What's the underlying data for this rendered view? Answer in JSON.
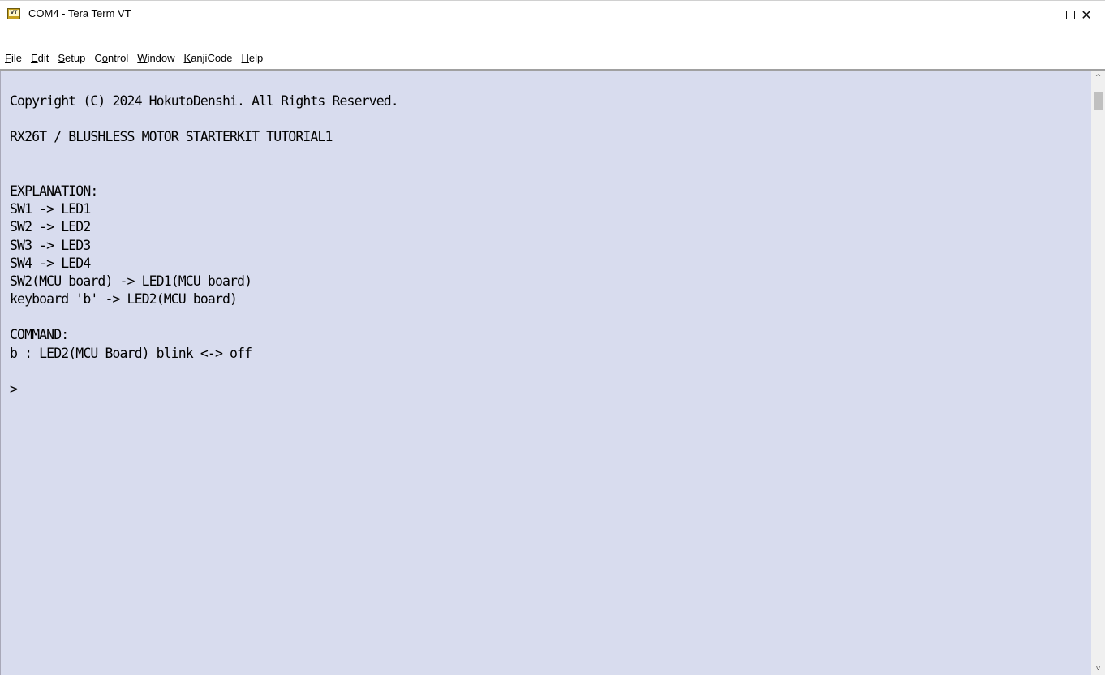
{
  "window": {
    "title": "COM4 - Tera Term VT",
    "icon": "teraterm-vt-icon",
    "icon_text": "VT",
    "controls": {
      "minimize_glyph": "—",
      "maximize_glyph": "☐",
      "close_glyph": "✕"
    }
  },
  "menu": {
    "items": [
      {
        "accel": "F",
        "rest": "ile"
      },
      {
        "accel": "E",
        "rest": "dit"
      },
      {
        "accel": "S",
        "rest": "etup"
      },
      {
        "pre": "C",
        "accel": "o",
        "rest": "ntrol"
      },
      {
        "accel": "W",
        "rest": "indow"
      },
      {
        "accel": "K",
        "rest": "anjiCode"
      },
      {
        "accel": "H",
        "rest": "elp"
      }
    ]
  },
  "terminal": {
    "background_color": "#d8dcee",
    "text_color": "#000000",
    "lines": [
      "Copyright (C) 2024 HokutoDenshi. All Rights Reserved.",
      "",
      "RX26T / BLUSHLESS MOTOR STARTERKIT TUTORIAL1",
      "",
      "",
      "EXPLANATION:",
      "SW1 -> LED1",
      "SW2 -> LED2",
      "SW3 -> LED3",
      "SW4 -> LED4",
      "SW2(MCU board) -> LED1(MCU board)",
      "keyboard 'b' -> LED2(MCU board)",
      "",
      "COMMAND:",
      "b : LED2(MCU Board) blink <-> off",
      "",
      ">"
    ]
  },
  "scrollbar": {
    "up_glyph": "^",
    "down_glyph": "v"
  }
}
